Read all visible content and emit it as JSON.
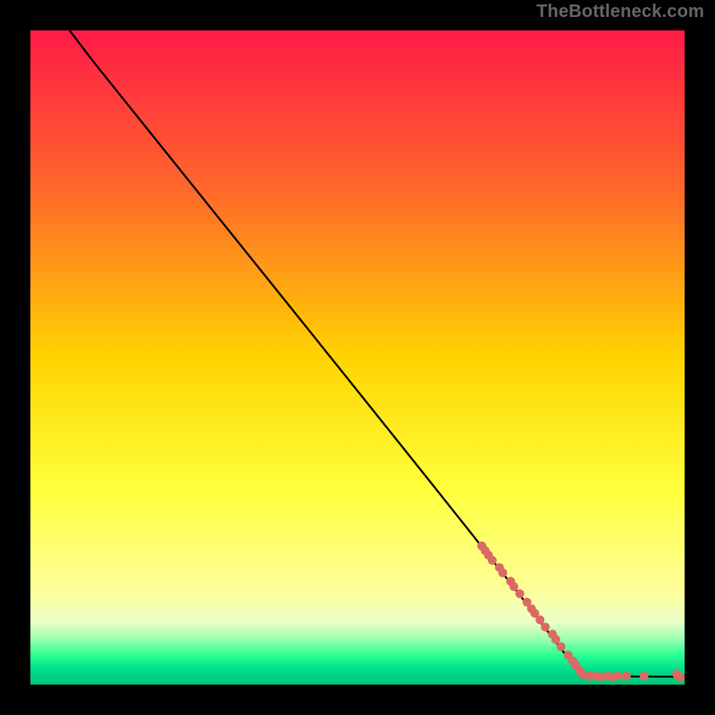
{
  "watermark": "TheBottleneck.com",
  "chart_data": {
    "type": "line",
    "title": "",
    "xlabel": "",
    "ylabel": "",
    "xlim": [
      0,
      100
    ],
    "ylim": [
      0,
      100
    ],
    "gradient_stops": [
      {
        "offset": 0,
        "color": "#ff1a47"
      },
      {
        "offset": 0.25,
        "color": "#ff6a2a"
      },
      {
        "offset": 0.5,
        "color": "#ffd400"
      },
      {
        "offset": 0.7,
        "color": "#ffff3a"
      },
      {
        "offset": 0.86,
        "color": "#fdff9c"
      },
      {
        "offset": 0.905,
        "color": "#e9ffc8"
      },
      {
        "offset": 0.93,
        "color": "#9cffb0"
      },
      {
        "offset": 0.955,
        "color": "#2bff93"
      },
      {
        "offset": 0.975,
        "color": "#00e08c"
      },
      {
        "offset": 1.0,
        "color": "#00c47a"
      }
    ],
    "curve": [
      {
        "x": 6,
        "y": 100
      },
      {
        "x": 9,
        "y": 96
      },
      {
        "x": 13,
        "y": 91
      },
      {
        "x": 70,
        "y": 20
      },
      {
        "x": 83,
        "y": 3
      },
      {
        "x": 84.5,
        "y": 1.3
      },
      {
        "x": 100,
        "y": 1.2
      }
    ],
    "scatter": {
      "color": "#da6a63",
      "radius": 5,
      "points": [
        {
          "x": 69,
          "y": 21.2
        },
        {
          "x": 69.5,
          "y": 20.5
        },
        {
          "x": 70.0,
          "y": 19.8
        },
        {
          "x": 70.6,
          "y": 19.0
        },
        {
          "x": 71.7,
          "y": 17.9
        },
        {
          "x": 72.2,
          "y": 17.1
        },
        {
          "x": 73.4,
          "y": 15.8
        },
        {
          "x": 73.9,
          "y": 15.0
        },
        {
          "x": 74.8,
          "y": 13.9
        },
        {
          "x": 75.9,
          "y": 12.6
        },
        {
          "x": 76.6,
          "y": 11.6
        },
        {
          "x": 77.1,
          "y": 10.9
        },
        {
          "x": 77.9,
          "y": 9.9
        },
        {
          "x": 78.7,
          "y": 8.8
        },
        {
          "x": 79.8,
          "y": 7.7
        },
        {
          "x": 80.3,
          "y": 6.9
        },
        {
          "x": 81.1,
          "y": 5.8
        },
        {
          "x": 82.2,
          "y": 4.5
        },
        {
          "x": 82.9,
          "y": 3.6
        },
        {
          "x": 83.4,
          "y": 2.9
        },
        {
          "x": 84.0,
          "y": 2.1
        },
        {
          "x": 84.5,
          "y": 1.5
        },
        {
          "x": 85.5,
          "y": 1.3
        },
        {
          "x": 86.4,
          "y": 1.3
        },
        {
          "x": 87.2,
          "y": 1.2
        },
        {
          "x": 88.2,
          "y": 1.3
        },
        {
          "x": 88.9,
          "y": 1.2
        },
        {
          "x": 89.8,
          "y": 1.3
        },
        {
          "x": 91.1,
          "y": 1.3
        },
        {
          "x": 93.8,
          "y": 1.3
        },
        {
          "x": 98.8,
          "y": 1.6
        },
        {
          "x": 99.3,
          "y": 1.1
        }
      ]
    }
  }
}
